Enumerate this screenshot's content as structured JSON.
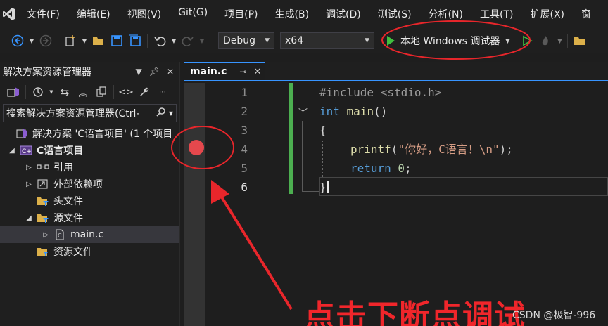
{
  "menubar": {
    "items": [
      "文件(F)",
      "编辑(E)",
      "视图(V)",
      "Git(G)",
      "项目(P)",
      "生成(B)",
      "调试(D)",
      "测试(S)",
      "分析(N)",
      "工具(T)",
      "扩展(X)",
      "窗"
    ]
  },
  "toolbar": {
    "config": "Debug",
    "platform": "x64",
    "run_label": "本地 Windows 调试器"
  },
  "solution_explorer": {
    "title": "解决方案资源管理器",
    "search_placeholder": "搜索解决方案资源管理器(Ctrl-",
    "tree": [
      {
        "label": "解决方案 'C语言项目' (1 个项目",
        "level": 0
      },
      {
        "label": "C语言项目",
        "level": 0
      },
      {
        "label": "引用",
        "level": 1
      },
      {
        "label": "外部依赖项",
        "level": 1
      },
      {
        "label": "头文件",
        "level": 1
      },
      {
        "label": "源文件",
        "level": 1
      },
      {
        "label": "main.c",
        "level": 2
      },
      {
        "label": "资源文件",
        "level": 1
      }
    ]
  },
  "editor": {
    "tab_name": "main.c",
    "line_numbers": [
      "1",
      "2",
      "3",
      "4",
      "5",
      "6"
    ],
    "lines": {
      "l1": "#include <stdio.h>",
      "l2_kw": "int",
      "l2_fn": " main",
      "l2_rest": "()",
      "l3": "{",
      "l4_fn": "printf",
      "l4_open": "(",
      "l4_str": "\"你好，C语言！\\n\"",
      "l4_close": ");",
      "l5_kw": "return",
      "l5_num": " 0",
      "l5_end": ";",
      "l6": "}"
    }
  },
  "annotation": {
    "text": "点击下断点调试",
    "color": "#f0262b"
  },
  "watermark": "CSDN @极智-996"
}
